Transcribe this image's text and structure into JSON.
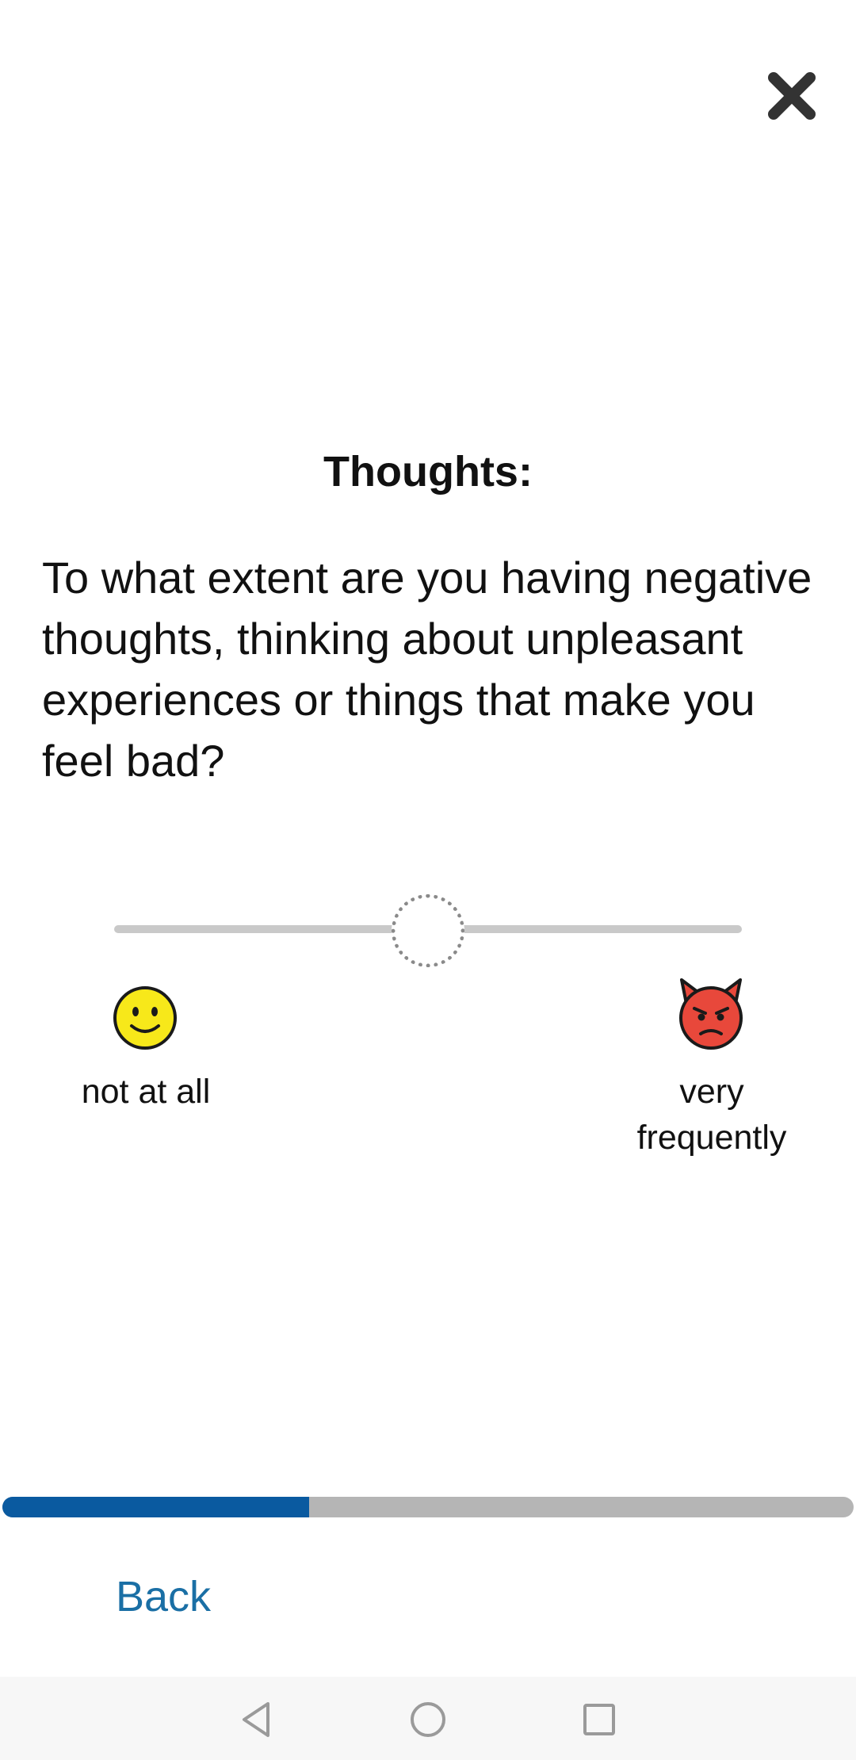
{
  "header": {
    "close_icon": "close-icon"
  },
  "question": {
    "title": "Thoughts:",
    "text": "To what extent are you having negative thoughts, thinking about unpleasant experiences or things that make you feel bad?"
  },
  "slider": {
    "value_fraction": 0.5,
    "thumb_style": "dotted-circle",
    "min_label": "not at all",
    "max_label": "very frequently",
    "min_icon": "slightly-smiling-face-icon",
    "max_icon": "angry-devil-face-icon",
    "track_color": "#c9c9c9"
  },
  "progress": {
    "fraction": 0.36,
    "fill_color": "#0a5aa0",
    "track_color": "#b5b5b5"
  },
  "footer": {
    "back_label": "Back",
    "back_color": "#1a6fa5"
  },
  "system_nav": {
    "back_icon": "nav-back-triangle-icon",
    "home_icon": "nav-home-circle-icon",
    "recents_icon": "nav-recents-square-icon"
  }
}
